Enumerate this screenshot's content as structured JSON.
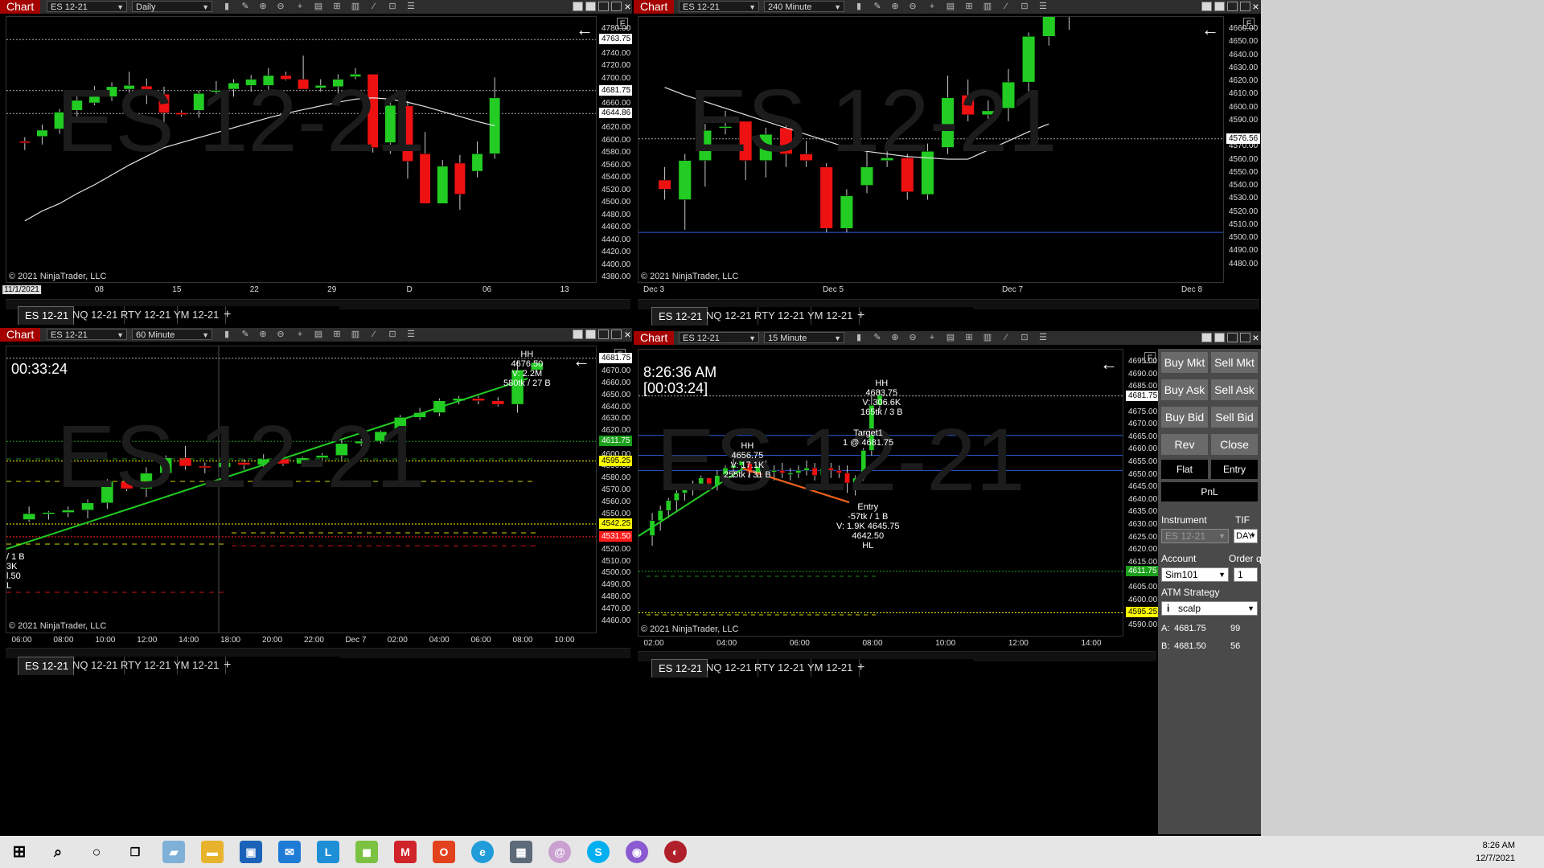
{
  "windows": [
    {
      "id": "tl",
      "chart_label": "Chart",
      "instrument": "ES 12-21",
      "period": "Daily",
      "watermark": "ES 12-21",
      "copyright": "© 2021 NinjaTrader, LLC",
      "f_button": "F",
      "y_ticks": [
        "4780.00",
        "4740.00",
        "4720.00",
        "4700.00",
        "4660.00",
        "4620.00",
        "4600.00",
        "4580.00",
        "4560.00",
        "4540.00",
        "4520.00",
        "4500.00",
        "4480.00",
        "4460.00",
        "4440.00",
        "4420.00",
        "4400.00",
        "4380.00"
      ],
      "price_tags": [
        {
          "text": "4763.75",
          "bg": "#ffffff",
          "fg": "#000000",
          "price": 4763.75
        },
        {
          "text": "4681.75",
          "bg": "#ffffff",
          "fg": "#000000",
          "price": 4681.75
        },
        {
          "text": "4644.86",
          "bg": "#ffffff",
          "fg": "#000000",
          "price": 4644.86
        }
      ],
      "x_ticks": [
        "11/1/2021",
        "08",
        "15",
        "22",
        "29",
        "D",
        "06",
        "13"
      ],
      "tabs": [
        "ES 12-21",
        "NQ 12-21",
        "RTY 12-21",
        "YM 12-21",
        "+"
      ]
    },
    {
      "id": "tr",
      "chart_label": "Chart",
      "instrument": "ES 12-21",
      "period": "240 Minute",
      "watermark": "ES 12-21",
      "copyright": "© 2021 NinjaTrader, LLC",
      "f_button": "F",
      "y_ticks": [
        "4660.00",
        "4650.00",
        "4640.00",
        "4630.00",
        "4620.00",
        "4610.00",
        "4600.00",
        "4590.00",
        "4570.00",
        "4560.00",
        "4550.00",
        "4540.00",
        "4530.00",
        "4520.00",
        "4510.00",
        "4500.00",
        "4490.00",
        "4480.00"
      ],
      "price_tags": [
        {
          "text": "4576.56",
          "bg": "#ffffff",
          "fg": "#000000",
          "price": 4576.56
        }
      ],
      "x_ticks": [
        "Dec 3",
        "Dec 5",
        "Dec 7",
        "Dec 8"
      ],
      "tabs": [
        "ES 12-21",
        "NQ 12-21",
        "RTY 12-21",
        "YM 12-21",
        "+"
      ]
    },
    {
      "id": "bl",
      "chart_label": "Chart",
      "instrument": "ES 12-21",
      "period": "60 Minute",
      "watermark": "ES 12-21",
      "copyright": "© 2021 NinjaTrader, LLC",
      "f_button": "F",
      "timer": "00:33:24",
      "annotations": [
        "HH",
        "4676.50",
        "V: 2.2M",
        "580tk / 27 B"
      ],
      "left_annotations": [
        "/ 1 B",
        "3K",
        "l.50",
        "L"
      ],
      "y_ticks": [
        "4670.00",
        "4660.00",
        "4650.00",
        "4640.00",
        "4630.00",
        "4620.00",
        "4600.00",
        "4590.00",
        "4580.00",
        "4570.00",
        "4560.00",
        "4550.00",
        "4540.00",
        "4520.00",
        "4510.00",
        "4500.00",
        "4490.00",
        "4480.00",
        "4470.00",
        "4460.00"
      ],
      "price_tags": [
        {
          "text": "4681.75",
          "bg": "#ffffff",
          "fg": "#000000",
          "price": 4681.75
        },
        {
          "text": "4611.75",
          "bg": "#1ca01c",
          "fg": "#ffffff",
          "price": 4611.75
        },
        {
          "text": "4595.25",
          "bg": "#ffff00",
          "fg": "#000000",
          "price": 4595.25
        },
        {
          "text": "4542.25",
          "bg": "#ffff00",
          "fg": "#000000",
          "price": 4542.25
        },
        {
          "text": "4531.50",
          "bg": "#ff1a1a",
          "fg": "#ffffff",
          "price": 4531.5
        }
      ],
      "x_ticks": [
        "06:00",
        "08:00",
        "10:00",
        "12:00",
        "14:00",
        "18:00",
        "20:00",
        "22:00",
        "Dec 7",
        "02:00",
        "04:00",
        "06:00",
        "08:00",
        "10:00"
      ],
      "tabs": [
        "ES 12-21",
        "NQ 12-21",
        "RTY 12-21",
        "YM 12-21",
        "+"
      ]
    },
    {
      "id": "br",
      "chart_label": "Chart",
      "instrument": "ES 12-21",
      "period": "15 Minute",
      "watermark": "ES 12-21",
      "copyright": "© 2021 NinjaTrader, LLC",
      "f_button": "F",
      "clock_time": "8:26:36 AM",
      "clock_timer": "[00:03:24]",
      "annotations": {
        "hh_top": [
          "HH",
          "4683.75",
          "V: 306.6K",
          "165tk / 3 B"
        ],
        "hh_mid": [
          "HH",
          "4656.75",
          "V: 17.1K",
          "255tk / 31 B"
        ],
        "target": [
          "Target1",
          "1 @ 4681.75"
        ],
        "entry": [
          "Entry",
          "-57tk / 1 B",
          "V: 1.9K 4645.75",
          "4642.50",
          "HL"
        ]
      },
      "y_ticks": [
        "4695.00",
        "4690.00",
        "4685.00",
        "4675.00",
        "4670.00",
        "4665.00",
        "4660.00",
        "4655.00",
        "4650.00",
        "4645.00",
        "4640.00",
        "4635.00",
        "4630.00",
        "4625.00",
        "4620.00",
        "4615.00",
        "4605.00",
        "4600.00",
        "4590.00"
      ],
      "price_tags": [
        {
          "text": "4681.75",
          "bg": "#ffffff",
          "fg": "#000000",
          "price": 4681.75
        },
        {
          "text": "4611.75",
          "bg": "#1ca01c",
          "fg": "#ffffff",
          "price": 4611.75
        },
        {
          "text": "4595.25",
          "bg": "#ffff00",
          "fg": "#000000",
          "price": 4595.25
        }
      ],
      "x_ticks": [
        "02:00",
        "04:00",
        "06:00",
        "08:00",
        "10:00",
        "12:00",
        "14:00"
      ],
      "tabs": [
        "ES 12-21",
        "NQ 12-21",
        "RTY 12-21",
        "YM 12-21",
        "+"
      ]
    }
  ],
  "chart_trader": {
    "buttons": [
      [
        "Buy Mkt",
        "Sell Mkt"
      ],
      [
        "Buy Ask",
        "Sell Ask"
      ],
      [
        "Buy Bid",
        "Sell Bid"
      ],
      [
        "Rev",
        "Close"
      ]
    ],
    "position": "Flat",
    "entry": "Entry",
    "pnl": "PnL",
    "instrument_label": "Instrument",
    "instrument_value": "ES 12-21",
    "tif_label": "TIF",
    "tif_value": "DAY",
    "account_label": "Account",
    "account_value": "Sim101",
    "order_qty_label": "Order qty",
    "order_qty_value": "1",
    "atm_label": "ATM Strategy",
    "atm_value": "scalp",
    "ask_label": "A:",
    "ask_price": "4681.75",
    "ask_size": "99",
    "bid_label": "B:",
    "bid_price": "4681.50",
    "bid_size": "56"
  },
  "taskbar": {
    "time": "8:26 AM",
    "date": "12/7/2021",
    "icons": [
      "windows-start",
      "search",
      "cortana",
      "task-view",
      "app-1",
      "file-explorer",
      "store",
      "mail",
      "app-l",
      "app-green",
      "mcafee",
      "office",
      "edge",
      "calculator",
      "app-swirl",
      "skype",
      "app-game",
      "app-red"
    ]
  },
  "chart_data": [
    {
      "type": "candlestick",
      "window": "ES 12-21 Daily",
      "ylim": [
        4380,
        4790
      ],
      "candles": [
        [
          4600,
          4607,
          4586,
          4598
        ],
        [
          4608,
          4627,
          4595,
          4618
        ],
        [
          4620,
          4652,
          4612,
          4647
        ],
        [
          4650,
          4675,
          4640,
          4666
        ],
        [
          4662,
          4689,
          4658,
          4676
        ],
        [
          4672,
          4695,
          4665,
          4688
        ],
        [
          4684,
          4712,
          4667,
          4690
        ],
        [
          4689,
          4701,
          4660,
          4677
        ],
        [
          4676,
          4688,
          4630,
          4646
        ],
        [
          4646,
          4650,
          4640,
          4643
        ],
        [
          4650,
          4682,
          4638,
          4677
        ],
        [
          4680,
          4697,
          4672,
          4682
        ],
        [
          4684,
          4700,
          4672,
          4694
        ],
        [
          4690,
          4707,
          4680,
          4700
        ],
        [
          4690,
          4718,
          4680,
          4706
        ],
        [
          4706,
          4712,
          4698,
          4700
        ],
        [
          4700,
          4738,
          4690,
          4684
        ],
        [
          4686,
          4700,
          4680,
          4690
        ],
        [
          4688,
          4708,
          4665,
          4700
        ],
        [
          4704,
          4718,
          4700,
          4708
        ],
        [
          4708,
          4708,
          4582,
          4590
        ],
        [
          4598,
          4668,
          4580,
          4658
        ],
        [
          4657,
          4665,
          4540,
          4568
        ],
        [
          4580,
          4615,
          4525,
          4500
        ],
        [
          4500,
          4570,
          4505,
          4560
        ],
        [
          4565,
          4578,
          4490,
          4515
        ],
        [
          4552,
          4600,
          4542,
          4580
        ],
        [
          4580,
          4703,
          4572,
          4670
        ]
      ],
      "sma": [
        4472,
        4488,
        4500,
        4516,
        4530,
        4546,
        4562,
        4576,
        4590,
        4598,
        4606,
        4614,
        4622,
        4630,
        4638,
        4645,
        4651,
        4657,
        4663,
        4668,
        4670,
        4668,
        4663,
        4656,
        4648,
        4640,
        4632,
        4625
      ]
    },
    {
      "type": "candlestick",
      "window": "ES 12-21 240 Minute",
      "ylim": [
        4470,
        4665
      ],
      "candles": [
        [
          4545,
          4555,
          4530,
          4538
        ],
        [
          4530,
          4565,
          4507,
          4560
        ],
        [
          4560,
          4588,
          4540,
          4583
        ],
        [
          4585,
          4598,
          4580,
          4586
        ],
        [
          4590,
          4590,
          4545,
          4560
        ],
        [
          4560,
          4585,
          4547,
          4580
        ],
        [
          4585,
          4587,
          4555,
          4565
        ],
        [
          4565,
          4575,
          4555,
          4560
        ],
        [
          4555,
          4558,
          4505,
          4508
        ],
        [
          4508,
          4538,
          4505,
          4533
        ],
        [
          4541,
          4567,
          4535,
          4555
        ],
        [
          4560,
          4567,
          4555,
          4562
        ],
        [
          4562,
          4565,
          4530,
          4536
        ],
        [
          4534,
          4573,
          4530,
          4567
        ],
        [
          4570,
          4625,
          4565,
          4608
        ],
        [
          4610,
          4622,
          4590,
          4595
        ],
        [
          4595,
          4606,
          4586,
          4598
        ],
        [
          4600,
          4630,
          4590,
          4620
        ],
        [
          4620,
          4658,
          4613,
          4655
        ],
        [
          4655,
          4683,
          4648,
          4675
        ],
        [
          4670,
          4683,
          4660,
          4678
        ]
      ],
      "sma": [
        4616,
        4610,
        4605,
        4600,
        4595,
        4590,
        4585,
        4580,
        4575,
        4570,
        4567,
        4565,
        4563,
        4562,
        4561,
        4561,
        4568,
        4575,
        4582,
        4588
      ]
    },
    {
      "type": "candlestick",
      "window": "ES 12-21 60 Minute",
      "ylim": [
        4455,
        4685
      ],
      "candles": [
        [
          4546,
          4557,
          4544,
          4551
        ],
        [
          4551,
          4553,
          4546,
          4552
        ],
        [
          4552,
          4557,
          4548,
          4554
        ],
        [
          4554,
          4563,
          4547,
          4560
        ],
        [
          4560,
          4580,
          4555,
          4578
        ],
        [
          4578,
          4580,
          4570,
          4572
        ],
        [
          4572,
          4590,
          4565,
          4585
        ],
        [
          4585,
          4600,
          4583,
          4598
        ],
        [
          4598,
          4608,
          4588,
          4591
        ],
        [
          4591,
          4594,
          4585,
          4590
        ],
        [
          4590,
          4593,
          4587,
          4594
        ],
        [
          4594,
          4597,
          4588,
          4592
        ],
        [
          4592,
          4601,
          4588,
          4597
        ],
        [
          4597,
          4599,
          4591,
          4593
        ],
        [
          4593,
          4599,
          4592,
          4598
        ],
        [
          4598,
          4602,
          4592,
          4600
        ],
        [
          4600,
          4614,
          4596,
          4610
        ],
        [
          4610,
          4614,
          4608,
          4612
        ],
        [
          4612,
          4621,
          4610,
          4620
        ],
        [
          4620,
          4634,
          4618,
          4632
        ],
        [
          4632,
          4640,
          4630,
          4636
        ],
        [
          4636,
          4648,
          4633,
          4646
        ],
        [
          4646,
          4650,
          4643,
          4648
        ],
        [
          4648,
          4650,
          4643,
          4646
        ],
        [
          4646,
          4649,
          4641,
          4643
        ],
        [
          4643,
          4680,
          4636,
          4672
        ],
        [
          4672,
          4680,
          4670,
          4678
        ]
      ]
    },
    {
      "type": "candlestick",
      "window": "ES 12-21 15 Minute",
      "ylim": [
        4588,
        4697
      ],
      "horizontal_lines": [
        4666,
        4658,
        4652
      ],
      "candles": [
        [
          4626,
          4635,
          4622,
          4632
        ],
        [
          4632,
          4638,
          4628,
          4636
        ],
        [
          4636,
          4641,
          4633,
          4640
        ],
        [
          4640,
          4644,
          4636,
          4643
        ],
        [
          4643,
          4646,
          4640,
          4645
        ],
        [
          4645,
          4648,
          4642,
          4646
        ],
        [
          4646,
          4650,
          4644,
          4649
        ],
        [
          4649,
          4649,
          4644,
          4646
        ],
        [
          4646,
          4652,
          4644,
          4650
        ],
        [
          4650,
          4654,
          4647,
          4653
        ],
        [
          4653,
          4657,
          4649,
          4654
        ],
        [
          4654,
          4657,
          4652,
          4656
        ],
        [
          4656,
          4657,
          4649,
          4651
        ],
        [
          4651,
          4655,
          4649,
          4654
        ],
        [
          4654,
          4656,
          4650,
          4652
        ],
        [
          4652,
          4654,
          4648,
          4652
        ],
        [
          4652,
          4655,
          4649,
          4651
        ],
        [
          4651,
          4653,
          4648,
          4651
        ],
        [
          4651,
          4654,
          4649,
          4652
        ],
        [
          4652,
          4656,
          4650,
          4653
        ],
        [
          4653,
          4655,
          4648,
          4650
        ],
        [
          4650,
          4654,
          4648,
          4653
        ],
        [
          4653,
          4655,
          4649,
          4652
        ],
        [
          4652,
          4654,
          4649,
          4651
        ],
        [
          4651,
          4654,
          4643,
          4647
        ],
        [
          4647,
          4650,
          4642,
          4649
        ],
        [
          4649,
          4661,
          4648,
          4660
        ],
        [
          4660,
          4682,
          4658,
          4678
        ],
        [
          4678,
          4684,
          4676,
          4682
        ]
      ]
    }
  ]
}
